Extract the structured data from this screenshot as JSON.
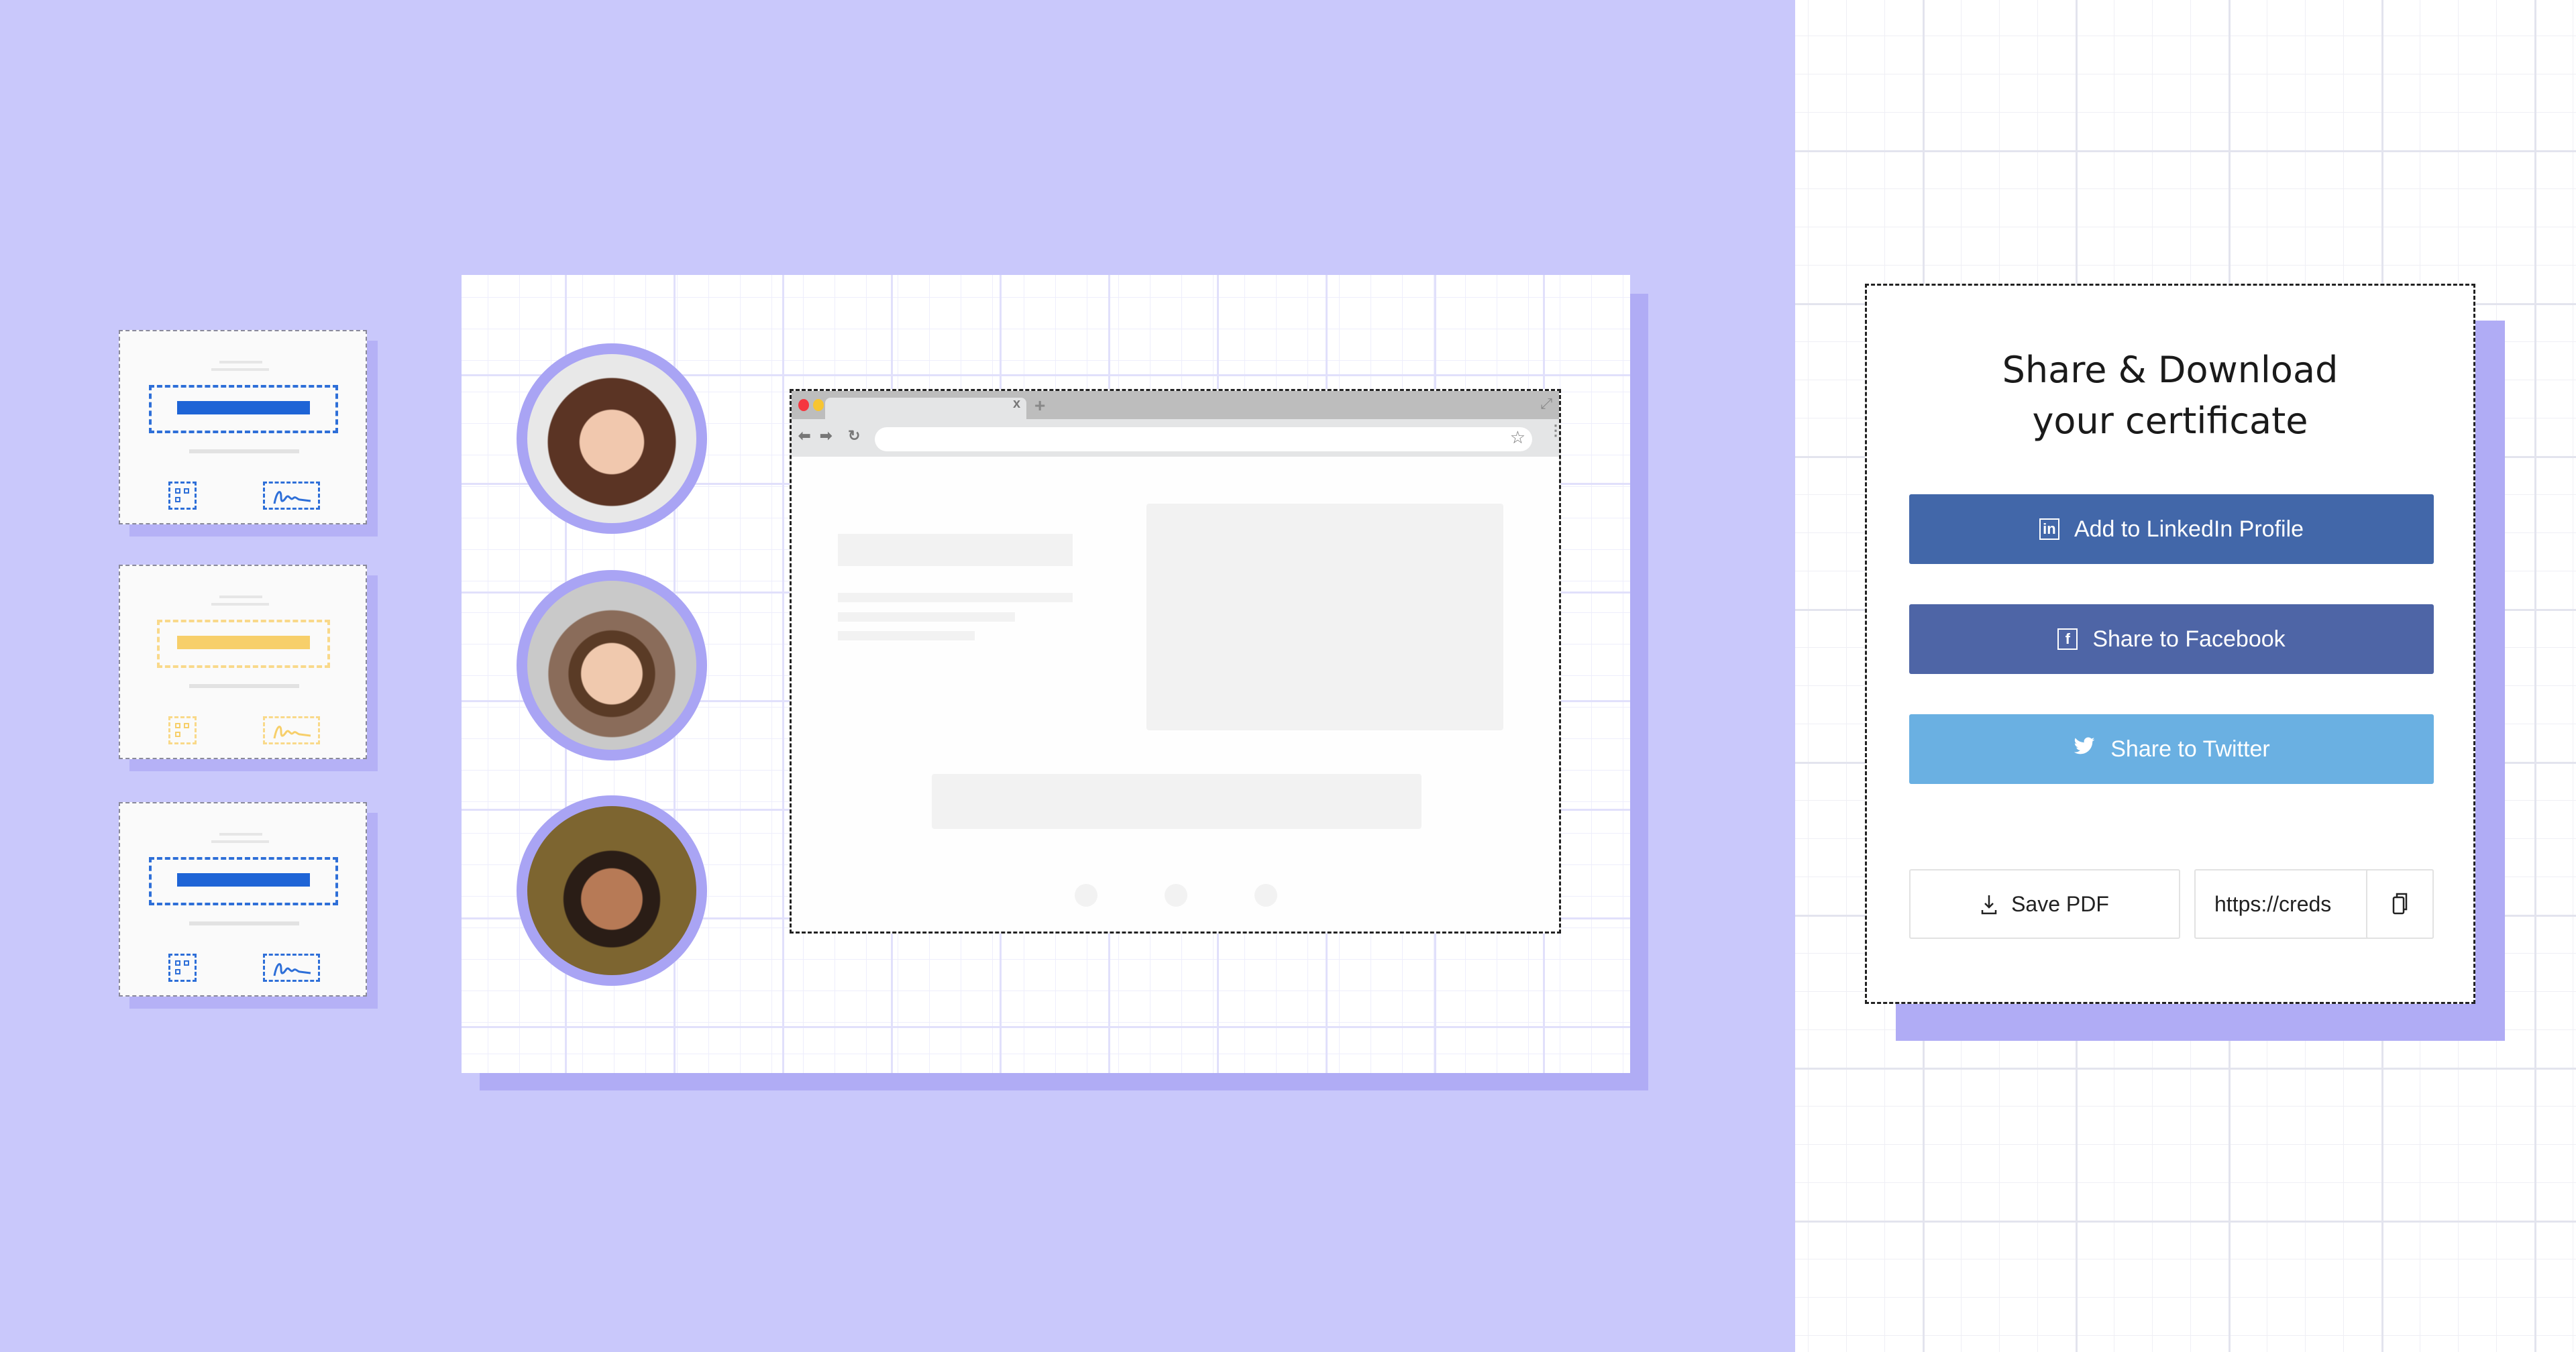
{
  "colors": {
    "lavender_bg": "#C9C8FB",
    "accent_purple": "#A9A4F4",
    "cert_blue": "#1E64D6",
    "cert_yellow": "#F7CF6A",
    "linkedin": "#4267A9",
    "facebook": "#4E65A6",
    "twitter": "#6AB0E2"
  },
  "certificates": [
    {
      "name": "certificate-blue",
      "color": "#1E64D6"
    },
    {
      "name": "certificate-yellow",
      "color": "#F7CF6A"
    },
    {
      "name": "certificate-blue-2",
      "color": "#1E64D6"
    }
  ],
  "avatars": [
    {
      "name": "avatar-girl-brown-hair"
    },
    {
      "name": "avatar-boy-headband"
    },
    {
      "name": "avatar-woman-glasses"
    }
  ],
  "browser": {
    "tab_close": "x",
    "new_tab": "+",
    "back": "⬅",
    "forward": "➡",
    "reload": "↻",
    "star": "☆",
    "expand": "⤢"
  },
  "share_card": {
    "title_line1": "Share & Download",
    "title_line2": "your certificate",
    "buttons": [
      {
        "label": "Add to LinkedIn Profile",
        "icon": "linkedin-icon",
        "glyph": "in"
      },
      {
        "label": "Share to Facebook",
        "icon": "facebook-icon",
        "glyph": "f"
      },
      {
        "label": "Share to Twitter",
        "icon": "twitter-icon",
        "glyph": "🐦"
      }
    ],
    "save_pdf_label": "Save PDF",
    "url_value": "https://creds"
  }
}
